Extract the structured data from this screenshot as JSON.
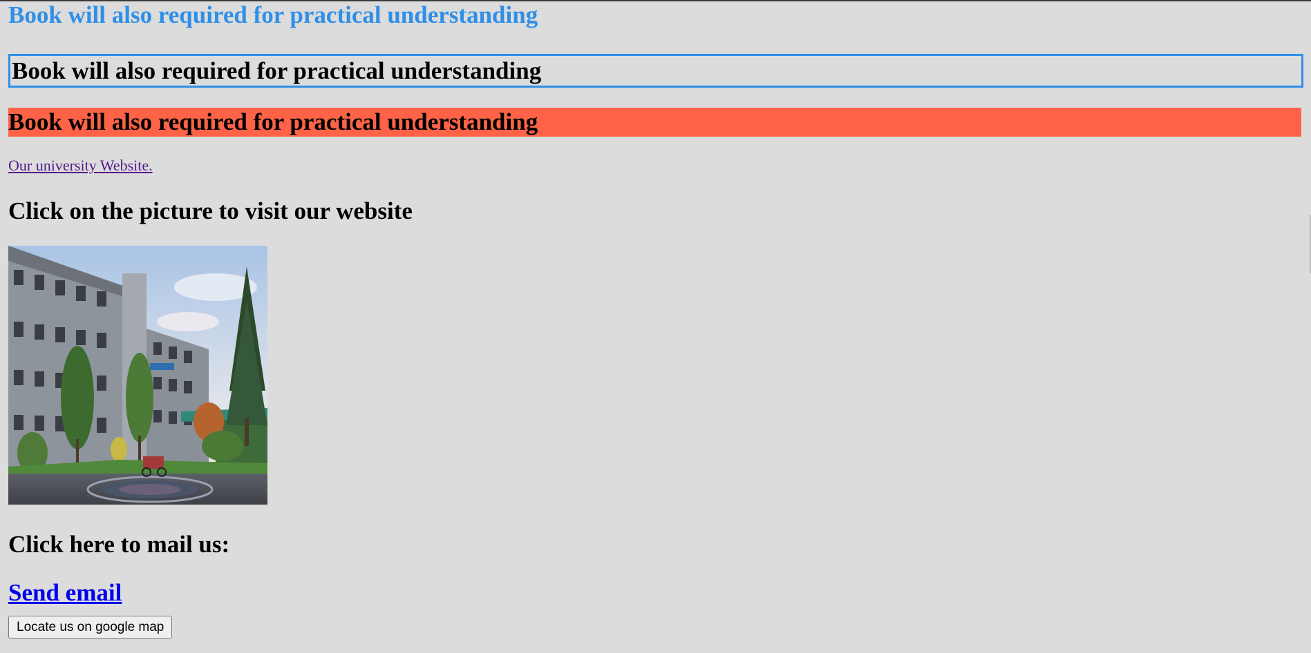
{
  "headings": {
    "blue_heading": "Book will also required for practical understanding",
    "boxed_heading": "Book will also required for practical understanding",
    "red_heading": "Book will also required for practical understanding",
    "picture_prompt": "Click on the picture to visit our website",
    "mail_prompt": "Click here to mail us:"
  },
  "links": {
    "university_website": "Our university Website.",
    "send_email": "Send email"
  },
  "buttons": {
    "locate_map": "Locate us on google map"
  },
  "colors": {
    "page_background": "#dcdcdc",
    "blue_accent": "#2f8fe8",
    "tomato_background": "#ff6347",
    "visited_link": "#551a8b",
    "link": "#0000ee"
  },
  "image": {
    "subject": "university building photo"
  }
}
